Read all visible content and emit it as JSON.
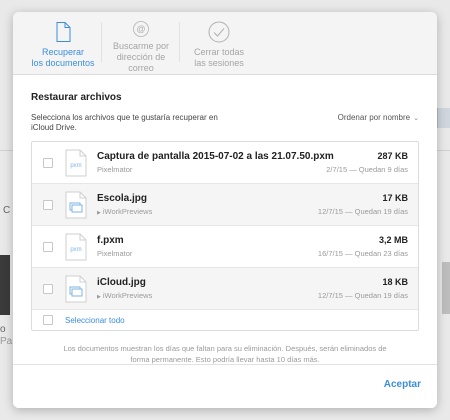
{
  "tabs": [
    {
      "label_1": "Recuperar",
      "label_2": "los documentos",
      "icon": "document-icon",
      "active": true
    },
    {
      "label_1": "Buscarme por",
      "label_2": "dirección de correo",
      "icon": "at-icon",
      "active": false
    },
    {
      "label_1": "Cerrar todas",
      "label_2": "las sesiones",
      "icon": "checkmark-icon",
      "active": false
    }
  ],
  "section": {
    "title": "Restaurar archivos",
    "description": "Selecciona los archivos que te gustaría recuperar en iCloud Drive.",
    "sort_label": "Ordenar por nombre"
  },
  "files": [
    {
      "name": "Captura de pantalla 2015-07-02 a las 21.07.50.pxm",
      "size": "287 KB",
      "app": "Pixelmator",
      "meta": "2/7/15 — Quedan 9 días",
      "icon": "pxm"
    },
    {
      "name": "Escola.jpg",
      "size": "17 KB",
      "app": "iWorkPreviews",
      "meta": "12/7/15 — Quedan 19 días",
      "icon": "image"
    },
    {
      "name": "f.pxm",
      "size": "3,2 MB",
      "app": "Pixelmator",
      "meta": "16/7/15 — Quedan 23 días",
      "icon": "pxm"
    },
    {
      "name": "iCloud.jpg",
      "size": "18 KB",
      "app": "iWorkPreviews",
      "meta": "12/7/15 — Quedan 19 días",
      "icon": "image"
    }
  ],
  "select_all_label": "Seleccionar todo",
  "footnote": "Los documentos muestran los días que faltan para su eliminación. Después, serán eliminados de forma permanente. Esto podría llevar hasta 10 días más.",
  "accept_label": "Aceptar",
  "background": {
    "letter_c": "C",
    "letter_p1": "o",
    "letter_p2": "Pa"
  },
  "colors": {
    "accent": "#3b8ede",
    "muted": "#9a9a9a"
  }
}
